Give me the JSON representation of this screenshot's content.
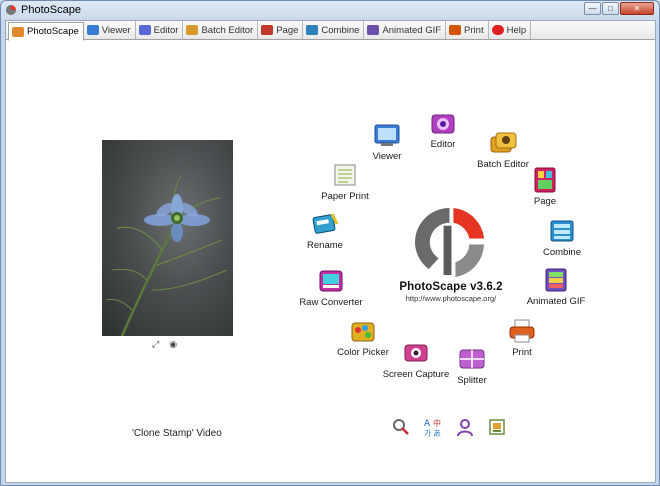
{
  "window": {
    "title": "PhotoScape",
    "controls": {
      "minimize": "—",
      "maximize": "□",
      "close": "✕"
    }
  },
  "tabs": [
    {
      "label": "PhotoScape",
      "icon": "photoscape-icon",
      "color": "#e08a2a",
      "active": true
    },
    {
      "label": "Viewer",
      "icon": "viewer-icon",
      "color": "#3a7bd5"
    },
    {
      "label": "Editor",
      "icon": "editor-icon",
      "color": "#5a67d8"
    },
    {
      "label": "Batch Editor",
      "icon": "batch-editor-icon",
      "color": "#d89a2a"
    },
    {
      "label": "Page",
      "icon": "page-icon",
      "color": "#c0392b"
    },
    {
      "label": "Combine",
      "icon": "combine-icon",
      "color": "#2c7fb8"
    },
    {
      "label": "Animated GIF",
      "icon": "animated-gif-icon",
      "color": "#6b4fa8"
    },
    {
      "label": "Print",
      "icon": "print-icon",
      "color": "#d35400"
    },
    {
      "label": "Help",
      "icon": "help-icon",
      "color": "#e02020"
    }
  ],
  "left_panel": {
    "video_label": "'Clone Stamp' Video"
  },
  "brand": {
    "name": "PhotoScape v3.6.2",
    "url": "http://www.photoscape.org/",
    "colors": {
      "gray": "#6a6a6a",
      "red": "#e53422"
    }
  },
  "menu": [
    {
      "id": "viewer",
      "label": "Viewer",
      "icon": "viewer-icon",
      "color": "#3a7bd5"
    },
    {
      "id": "editor",
      "label": "Editor",
      "icon": "editor-icon",
      "color": "#b040c0"
    },
    {
      "id": "batch-editor",
      "label": "Batch Editor",
      "icon": "batch-editor-icon",
      "color": "#e0a020"
    },
    {
      "id": "page",
      "label": "Page",
      "icon": "page-icon",
      "color": "#d02060"
    },
    {
      "id": "combine",
      "label": "Combine",
      "icon": "combine-icon",
      "color": "#2a90d0"
    },
    {
      "id": "animated-gif",
      "label": "Animated GIF",
      "icon": "animated-gif-icon",
      "color": "#7050c0"
    },
    {
      "id": "print",
      "label": "Print",
      "icon": "print-icon",
      "color": "#e06020"
    },
    {
      "id": "splitter",
      "label": "Splitter",
      "icon": "splitter-icon",
      "color": "#c060d0"
    },
    {
      "id": "screen-capture",
      "label": "Screen Capture",
      "icon": "screen-capture-icon",
      "color": "#d04090"
    },
    {
      "id": "color-picker",
      "label": "Color Picker",
      "icon": "color-picker-icon",
      "color": "#e0b020"
    },
    {
      "id": "raw-converter",
      "label": "Raw Converter",
      "icon": "raw-converter-icon",
      "color": "#c030a0"
    },
    {
      "id": "rename",
      "label": "Rename",
      "icon": "rename-icon",
      "color": "#30a0d0"
    },
    {
      "id": "paper-print",
      "label": "Paper Print",
      "icon": "paper-print-icon",
      "color": "#80b040"
    }
  ],
  "bottom_tools": [
    {
      "icon": "settings-icon"
    },
    {
      "icon": "language-icon"
    },
    {
      "icon": "user-icon"
    },
    {
      "icon": "photo-frame-icon"
    }
  ]
}
